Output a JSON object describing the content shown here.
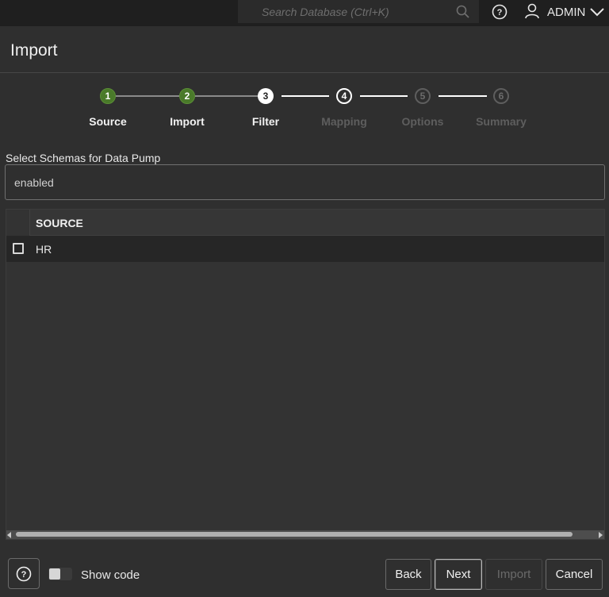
{
  "topbar": {
    "search_placeholder": "Search Database (Ctrl+K)",
    "user_name": "ADMIN"
  },
  "header": {
    "title": "Import"
  },
  "stepper": {
    "steps": [
      {
        "number": "1",
        "label": "Source",
        "state": "done"
      },
      {
        "number": "2",
        "label": "Import",
        "state": "done"
      },
      {
        "number": "3",
        "label": "Filter",
        "state": "current"
      },
      {
        "number": "4",
        "label": "Mapping",
        "state": "next"
      },
      {
        "number": "5",
        "label": "Options",
        "state": "future"
      },
      {
        "number": "6",
        "label": "Summary",
        "state": "future"
      }
    ]
  },
  "schemas": {
    "label": "Select Schemas for Data Pump",
    "value": "enabled"
  },
  "grid": {
    "column_header": "SOURCE",
    "rows": [
      {
        "label": "HR",
        "checked": false
      }
    ]
  },
  "footer": {
    "show_code_label": "Show code",
    "back_label": "Back",
    "next_label": "Next",
    "import_label": "Import",
    "cancel_label": "Cancel"
  },
  "colors": {
    "background": "#2f2f2f",
    "topbar": "#1f1f1f",
    "step_done": "#4a7a2a",
    "disabled_text": "#5e5e5e"
  }
}
